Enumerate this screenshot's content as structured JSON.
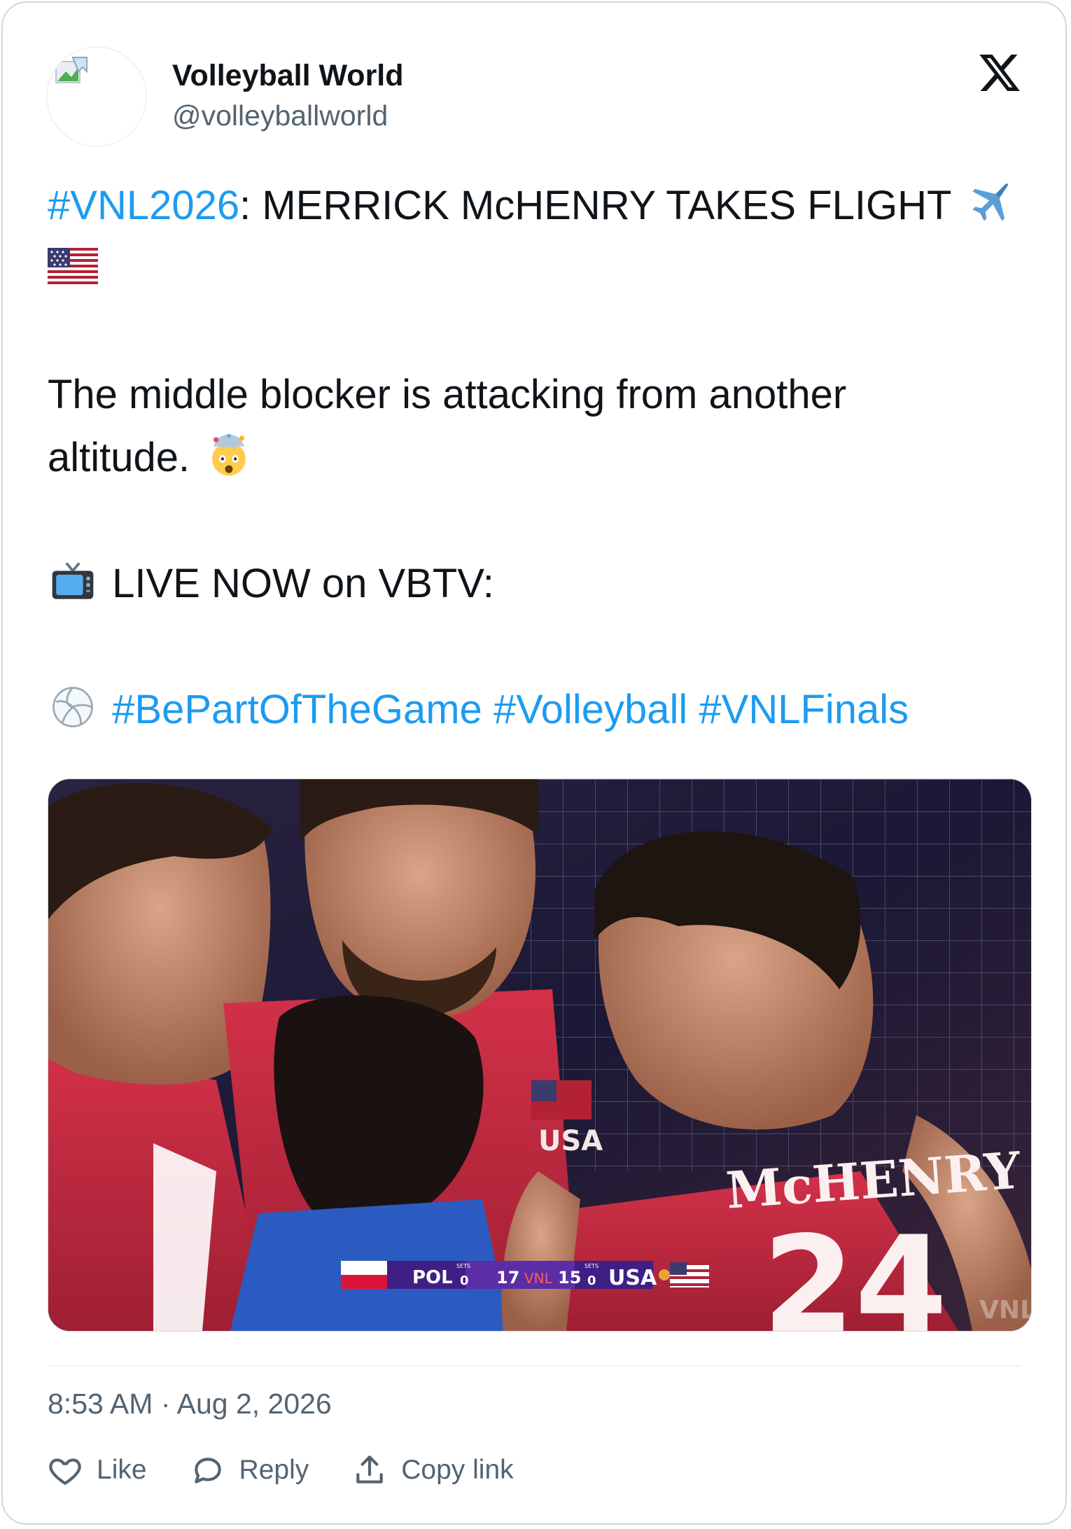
{
  "author": {
    "name": "Volleyball World",
    "handle": "@volleyballworld"
  },
  "tweet": {
    "hashtag_main": "#VNL2026",
    "line1_rest": ": MERRICK McHENRY TAKES FLIGHT",
    "line1_emoji": "airplane-icon",
    "line2_emoji": "us-flag-icon",
    "para2_line1": "The middle blocker is attacking from another",
    "para2_line2": "altitude.",
    "para2_emoji": "exploding-head-icon",
    "para3_emoji": "television-icon",
    "para3_text": "LIVE NOW on VBTV:",
    "para4_emoji": "volleyball-icon",
    "hashtags": [
      "#BePartOfTheGame",
      "#Volleyball",
      "#VNLFinals"
    ]
  },
  "media": {
    "scoreboard": {
      "team_left": "POL",
      "sets_label": "SETS",
      "sets_left": "0",
      "score_left": "17",
      "league": "VNL",
      "score_right": "15",
      "sets_right": "0",
      "team_right": "USA"
    },
    "jersey_name": "McHENRY",
    "jersey_number": "24",
    "chest_text": "USA",
    "watermark": "VNL"
  },
  "timestamp": "8:53 AM · Aug 2, 2026",
  "actions": {
    "like": "Like",
    "reply": "Reply",
    "copy_link": "Copy link"
  },
  "colors": {
    "hashtag": "#1d9bf0",
    "text": "#0f1419",
    "secondary": "#536471",
    "jersey_red": "#c8283e"
  }
}
